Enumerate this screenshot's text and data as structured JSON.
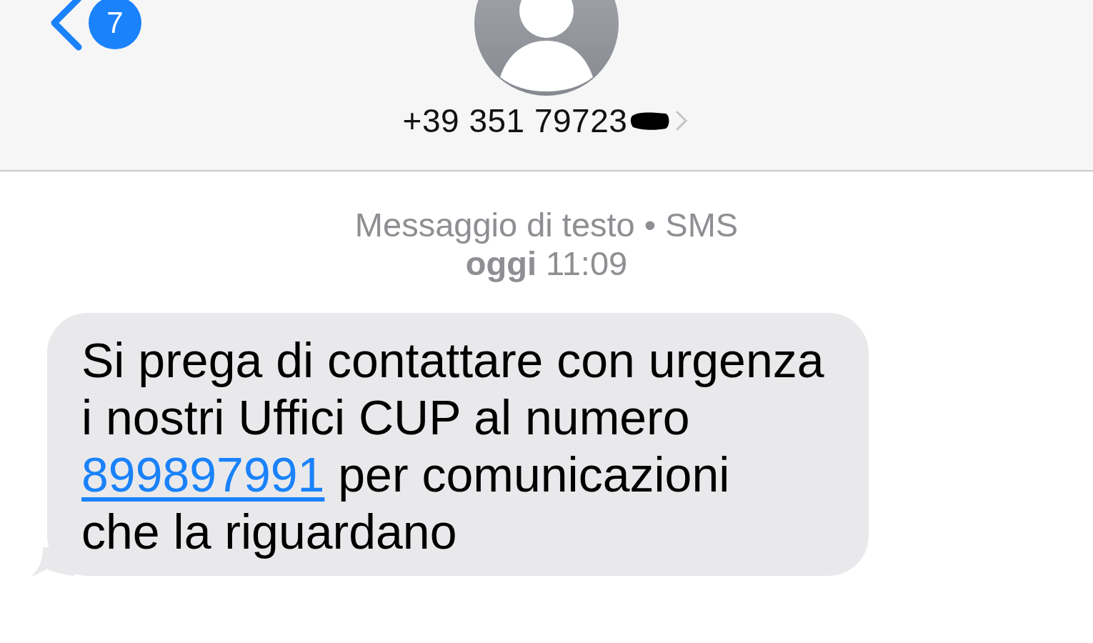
{
  "header": {
    "back_badge": "7",
    "contact": "+39 351 79723",
    "redacted": true
  },
  "conversation": {
    "service": "Messaggio di testo • SMS",
    "time": "**oggi** 11:09",
    "messages": [
      {
        "kind": "incoming",
        "before": "Si prega di contattare con urgenza\ni nostri Uffici CUP al numero\n",
        "link": "899897991",
        "after": " per comunicazioni\nche la riguardano"
      }
    ]
  }
}
